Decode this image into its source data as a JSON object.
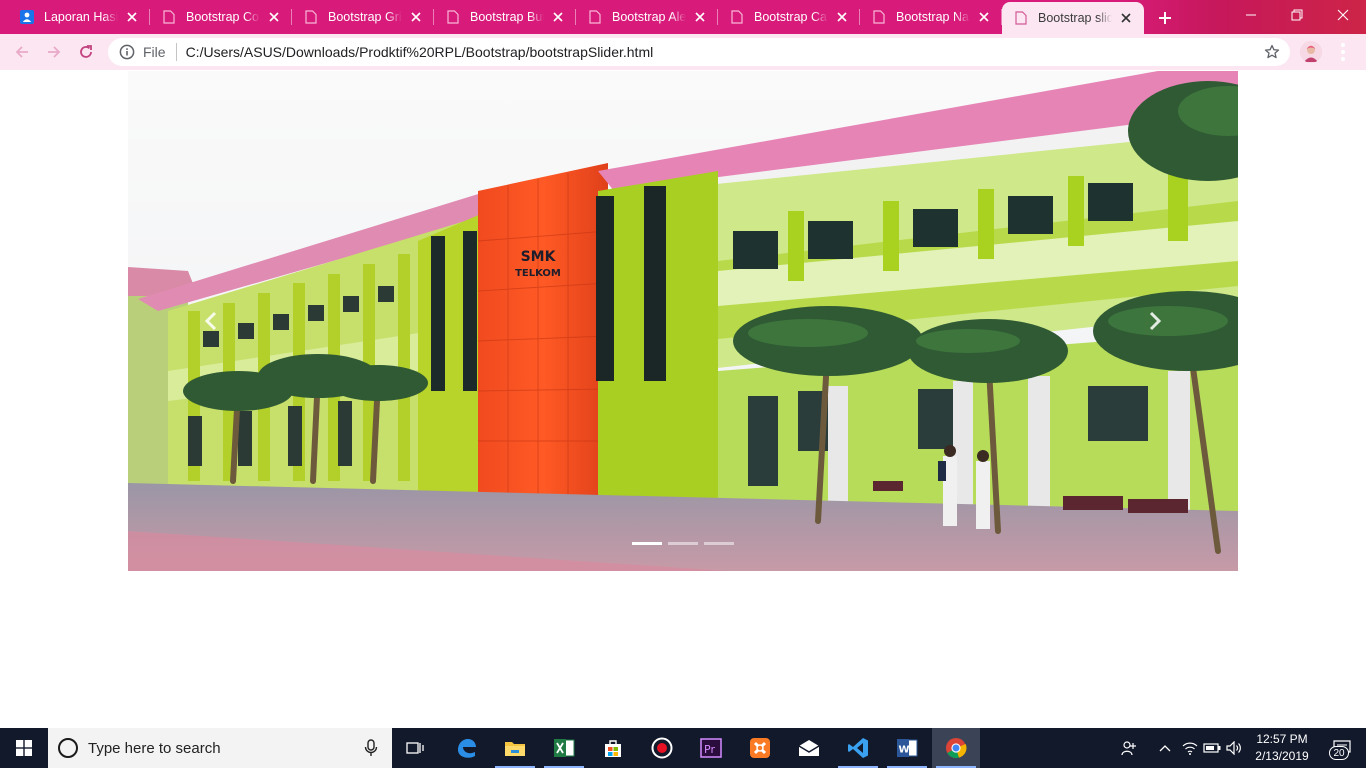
{
  "browser": {
    "tabs": [
      {
        "label": "Laporan Hasil Prakerin",
        "favicon": "contact-doc-icon",
        "active": false
      },
      {
        "label": "Bootstrap Colors",
        "favicon": "file-icon",
        "active": false
      },
      {
        "label": "Bootstrap Grid",
        "favicon": "file-icon",
        "active": false
      },
      {
        "label": "Bootstrap Buttons",
        "favicon": "file-icon",
        "active": false
      },
      {
        "label": "Bootstrap Alerts",
        "favicon": "file-icon",
        "active": false
      },
      {
        "label": "Bootstrap Cards",
        "favicon": "file-icon",
        "active": false
      },
      {
        "label": "Bootstrap Navbar",
        "favicon": "file-icon",
        "active": false
      },
      {
        "label": "Bootstrap slider",
        "favicon": "file-icon",
        "active": true
      }
    ],
    "address": {
      "scheme_label": "File",
      "url": "C:/Users/ASUS/Downloads/Prodktif%20RPL/Bootstrap/bootstrapSlider.html"
    },
    "theme_color": "#d81b7a",
    "toolbar_color": "#fbe6f1"
  },
  "page": {
    "carousel": {
      "slide_count": 3,
      "active_slide": 1,
      "image_subject": "school-building-photo",
      "building_sign": [
        "SMK",
        "TELKOM"
      ]
    }
  },
  "taskbar": {
    "search_placeholder": "Type here to search",
    "pinned": [
      "task-view-icon",
      "edge-icon",
      "file-explorer-icon",
      "excel-icon",
      "store-icon",
      "record-icon",
      "premiere-icon",
      "xampp-icon",
      "mail-icon",
      "vscode-icon",
      "word-icon",
      "chrome-icon"
    ],
    "clock_time": "12:57 PM",
    "clock_date": "2/13/2019",
    "notification_count": "20"
  }
}
